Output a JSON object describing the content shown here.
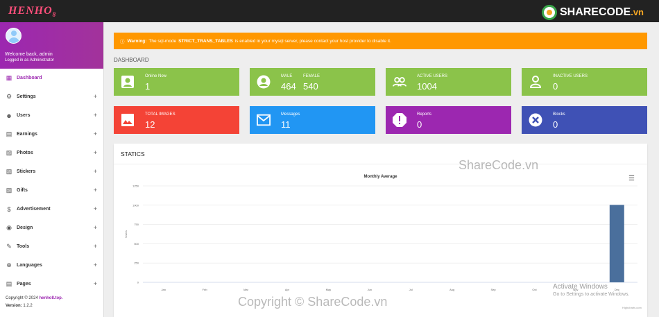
{
  "brand": {
    "logo_text": "HENHO",
    "logo_sub": "8",
    "sharecode_text": "SHARECODE",
    "sharecode_suffix": ".vn"
  },
  "sidebar": {
    "welcome": "Welcome back, admin",
    "role": "Logged in as Administrator",
    "items": [
      {
        "label": "Dashboard",
        "icon": "dashboard-icon",
        "glyph": "▦",
        "active": true
      },
      {
        "label": "Settings",
        "icon": "gear-icon",
        "glyph": "⚙"
      },
      {
        "label": "Users",
        "icon": "user-icon",
        "glyph": "☻"
      },
      {
        "label": "Earnings",
        "icon": "money-icon",
        "glyph": "▤"
      },
      {
        "label": "Photos",
        "icon": "photo-icon",
        "glyph": "▨"
      },
      {
        "label": "Stickers",
        "icon": "sticker-icon",
        "glyph": "▨"
      },
      {
        "label": "Gifts",
        "icon": "gift-icon",
        "glyph": "▨"
      },
      {
        "label": "Advertisement",
        "icon": "dollar-icon",
        "glyph": "$"
      },
      {
        "label": "Design",
        "icon": "palette-icon",
        "glyph": "◉"
      },
      {
        "label": "Tools",
        "icon": "wrench-icon",
        "glyph": "✎"
      },
      {
        "label": "Languages",
        "icon": "globe-icon",
        "glyph": "⊕"
      },
      {
        "label": "Pages",
        "icon": "page-icon",
        "glyph": "▤"
      }
    ],
    "plus": "+",
    "copyright_prefix": "Copyright © 2024 ",
    "copyright_site": "henho8.top.",
    "version_label": "Version:",
    "version_value": "1.2.2"
  },
  "warning": {
    "prefix": "Warning:",
    "text_before": "The sql-mode",
    "mode": "STRICT_TRANS_TABLES",
    "text_after": "is enabled in your mysql server, please contact your host provider to disable it."
  },
  "section_label": "DASHBOARD",
  "cards": [
    {
      "label": "Online Now",
      "value": "1",
      "color": "#8bc34a",
      "icon": "account-box-icon"
    },
    {
      "label": "MALE",
      "value": "464",
      "label2": "FEMALE",
      "value2": "540",
      "color": "#8bc34a",
      "icon": "face-icon"
    },
    {
      "label": "ACTIVE USERS",
      "value": "1004",
      "color": "#8bc34a",
      "icon": "people-icon"
    },
    {
      "label": "INACTIVE USERS",
      "value": "0",
      "color": "#8bc34a",
      "icon": "person-outline-icon"
    },
    {
      "label": "TOTAL IMAGES",
      "value": "12",
      "color": "#f44336",
      "icon": "image-icon"
    },
    {
      "label": "Messages",
      "value": "11",
      "color": "#2196f3",
      "icon": "mail-icon"
    },
    {
      "label": "Reports",
      "value": "0",
      "color": "#9c27b0",
      "icon": "alert-icon"
    },
    {
      "label": "Blocks",
      "value": "0",
      "color": "#3f51b5",
      "icon": "block-icon"
    }
  ],
  "panel": {
    "title": "STATICS",
    "menu_icon": "menu-icon"
  },
  "chart_data": {
    "type": "bar",
    "title": "Monthly Average",
    "ylabel": "Users",
    "categories": [
      "Jan",
      "Feb",
      "Mar",
      "Apr",
      "May",
      "Jun",
      "Jul",
      "Aug",
      "Sep",
      "Oct",
      "Nov",
      "Dec"
    ],
    "values": [
      0,
      0,
      0,
      0,
      0,
      0,
      0,
      0,
      0,
      0,
      0,
      1004
    ],
    "yticks": [
      0,
      250,
      500,
      750,
      1000,
      1250
    ],
    "ylim": [
      0,
      1250
    ],
    "bar_color": "#434348",
    "highlight_color": "#4a6f9c",
    "grid": true,
    "credit": "Highcharts.com"
  },
  "watermarks": {
    "top": "ShareCode.vn",
    "bottom": "Copyright © ShareCode.vn",
    "activate_title": "Activate Windows",
    "activate_sub": "Go to Settings to activate Windows."
  }
}
